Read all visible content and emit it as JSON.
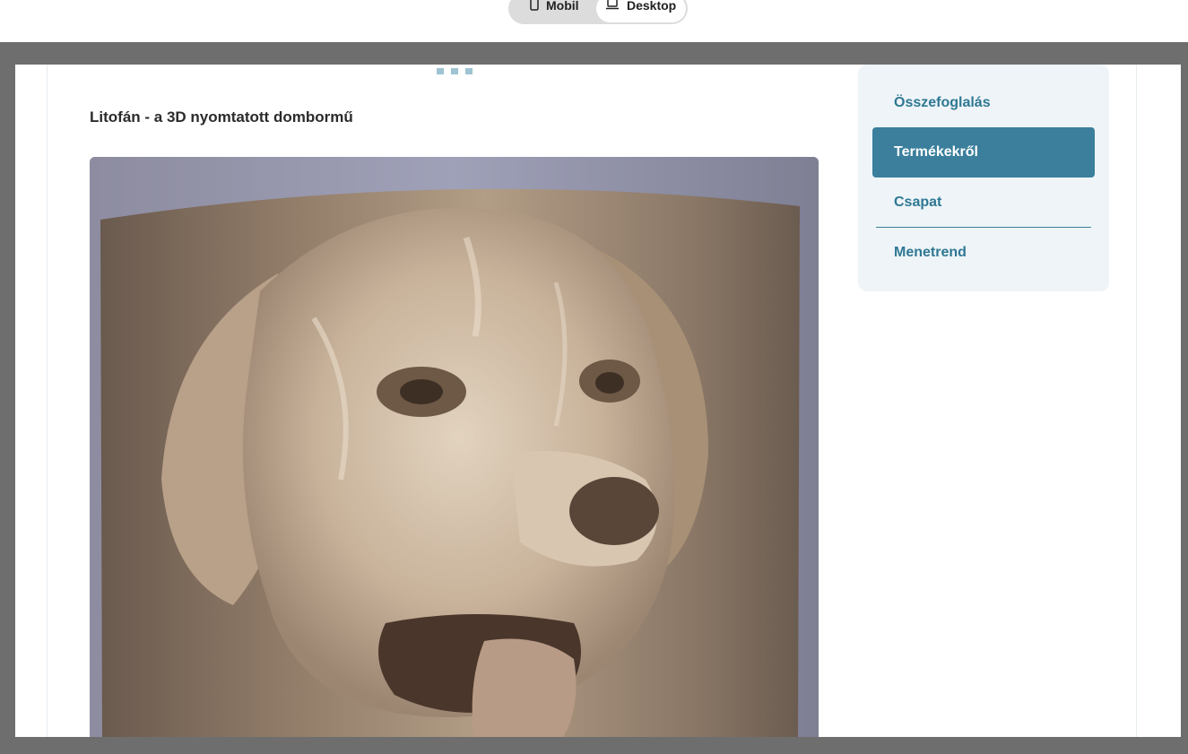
{
  "toolbar": {
    "mobile_label": "Mobil",
    "desktop_label": "Desktop",
    "mobile_icon": "phone-icon",
    "desktop_icon": "laptop-icon",
    "selected": "Desktop"
  },
  "article": {
    "title": "Litofán - a 3D nyomtatott dombormű",
    "image_icon": "dog-lithophane-photo"
  },
  "sidenav": {
    "items": [
      {
        "label": "Összefoglalás",
        "active": false
      },
      {
        "label": "Termékekről",
        "active": true
      },
      {
        "label": "Csapat",
        "active": false
      },
      {
        "label": "Menetrend",
        "active": false
      }
    ]
  },
  "colors": {
    "accent": "#3b7f9c",
    "nav_text": "#2e7894",
    "nav_bg": "#eef4f7",
    "frame": "#6e6e6e"
  }
}
